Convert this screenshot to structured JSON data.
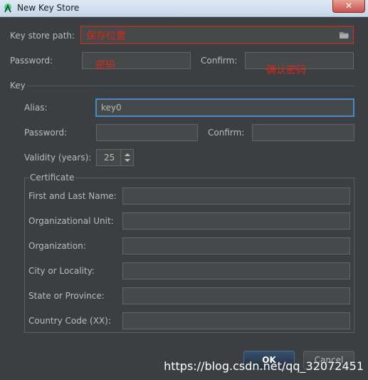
{
  "window": {
    "title": "New Key Store",
    "close_glyph": "✕"
  },
  "keystore": {
    "path_label": "Key store path:",
    "path_value": "",
    "path_note": "保存位置",
    "password_label": "Password:",
    "password_note": "密码",
    "confirm_label": "Confirm:",
    "confirm_note": "确认密码"
  },
  "key": {
    "section_label": "Key",
    "alias_label": "Alias:",
    "alias_value": "key0",
    "password_label": "Password:",
    "confirm_label": "Confirm:",
    "validity_label": "Validity (years):",
    "validity_value": "25"
  },
  "certificate": {
    "title": "Certificate",
    "fields": [
      {
        "label": "First and Last Name:",
        "value": ""
      },
      {
        "label": "Organizational Unit:",
        "value": ""
      },
      {
        "label": "Organization:",
        "value": ""
      },
      {
        "label": "City or Locality:",
        "value": ""
      },
      {
        "label": "State or Province:",
        "value": ""
      },
      {
        "label": "Country Code (XX):",
        "value": ""
      }
    ]
  },
  "buttons": {
    "ok": "OK",
    "cancel": "Cancel"
  },
  "watermark": "https://blog.csdn.net/qq_32072451",
  "colors": {
    "accent": "#4a88c7",
    "annotation_red": "#e0281e",
    "panel": "#3c3f41"
  }
}
